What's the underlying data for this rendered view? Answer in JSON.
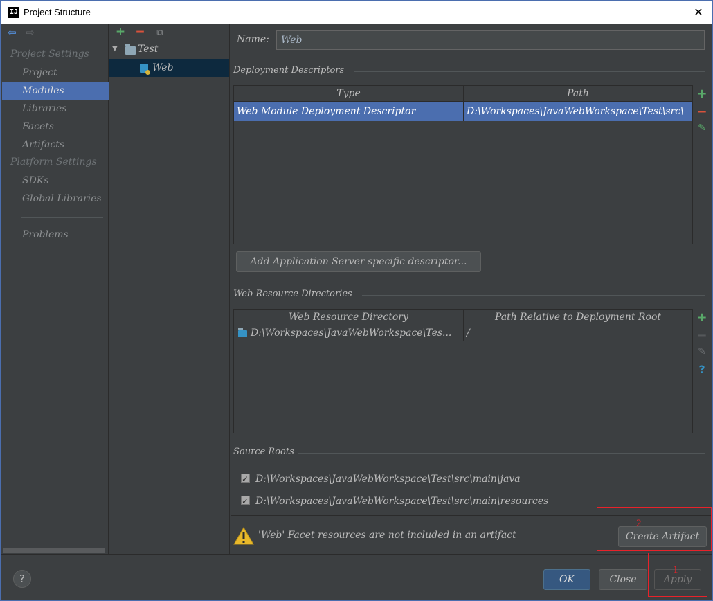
{
  "window": {
    "title": "Project Structure",
    "app_icon_text": "IJ",
    "close_glyph": "✕"
  },
  "nav": {
    "back_glyph": "⇦",
    "forward_glyph": "⇨",
    "project_settings_label": "Project Settings",
    "platform_settings_label": "Platform Settings",
    "items": {
      "project": "Project",
      "modules": "Modules",
      "libraries": "Libraries",
      "facets": "Facets",
      "artifacts": "Artifacts",
      "sdks": "SDKs",
      "global_libraries": "Global Libraries",
      "problems": "Problems"
    }
  },
  "tree": {
    "add_glyph": "+",
    "remove_glyph": "−",
    "copy_glyph": "⧉",
    "expand_glyph": "▼",
    "root_label": "Test",
    "child_label": "Web"
  },
  "detail": {
    "name_label": "Name:",
    "name_value": "Web",
    "deployment_title": "Deployment Descriptors",
    "deployment_columns": [
      "Type",
      "Path"
    ],
    "deployment_rows": [
      {
        "type": "Web Module Deployment Descriptor",
        "path": "D:\\Workspaces\\JavaWebWorkspace\\Test\\src\\"
      }
    ],
    "add_server_descriptor_label": "Add Application Server specific descriptor...",
    "web_resource_title": "Web Resource Directories",
    "web_resource_columns": [
      "Web Resource Directory",
      "Path Relative to Deployment Root"
    ],
    "web_resource_rows": [
      {
        "directory": "D:\\Workspaces\\JavaWebWorkspace\\Tes...",
        "relative": "/"
      }
    ],
    "source_roots_title": "Source Roots",
    "source_roots": [
      "D:\\Workspaces\\JavaWebWorkspace\\Test\\src\\main\\java",
      "D:\\Workspaces\\JavaWebWorkspace\\Test\\src\\main\\resources"
    ],
    "warning_text": "'Web' Facet resources are not included in an artifact",
    "create_artifact_label": "Create Artifact",
    "side_add": "+",
    "side_remove": "−",
    "side_edit": "✎",
    "side_help": "?"
  },
  "footer": {
    "help_glyph": "?",
    "ok_label": "OK",
    "close_label": "Close",
    "apply_label": "Apply"
  },
  "annotations": {
    "first": "1",
    "second": "2"
  },
  "colors": {
    "background": "#3c3f41",
    "selection": "#4b6eaf",
    "tree_selection": "#0d293e",
    "add_green": "#59a869",
    "remove_red": "#d9523c",
    "annotation_red": "#e8222a",
    "primary_button": "#365880"
  }
}
